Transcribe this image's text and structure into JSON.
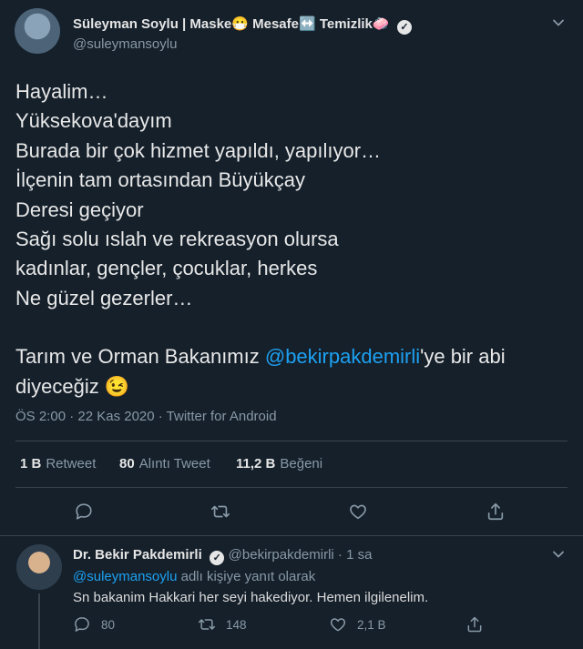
{
  "tweet": {
    "author_name": "Süleyman Soylu | Maske😷 Mesafe↔️ Temizlik🧼",
    "author_handle": "@suleymansoylu",
    "text_lines": [
      "Hayalim…",
      "Yüksekova'dayım",
      "Burada bir çok hizmet yapıldı, yapılıyor…",
      "İlçenin tam ortasından Büyükçay",
      "Deresi geçiyor",
      "Sağı solu ıslah ve rekreasyon olursa",
      "kadınlar, gençler, çocuklar, herkes",
      "Ne güzel gezerler…"
    ],
    "mention_prefix": "Tarım ve Orman Bakanımız ",
    "mention": "@bekirpakdemirli",
    "mention_suffix": "'ye bir abi",
    "last_line": "diyeceğiz 😉",
    "timestamp": "ÖS 2:00 · 22 Kas 2020 · Twitter for Android",
    "retweets_count": "1 B",
    "retweets_label": "Retweet",
    "quotes_count": "80",
    "quotes_label": "Alıntı Tweet",
    "likes_count": "11,2 B",
    "likes_label": "Beğeni"
  },
  "reply": {
    "author_name": "Dr. Bekir Pakdemirli",
    "author_handle": "@bekirpakdemirli",
    "time": " · 1 sa",
    "replying_handle": "@suleymansoylu",
    "replying_suffix": " adlı kişiye yanıt olarak",
    "text": "Sn bakanim Hakkari her seyi hakediyor. Hemen ilgilenelim.",
    "reply_count": "80",
    "retweet_count": "148",
    "like_count": "2,1 B"
  },
  "icons": {
    "reply": "reply-icon",
    "retweet": "retweet-icon",
    "like": "heart-icon",
    "share": "share-icon",
    "more": "chevron-down-icon",
    "verified": "verified-badge-icon"
  },
  "colors": {
    "background": "#15202b",
    "accent": "#1da1f2",
    "secondary_text": "#8899a6",
    "divider": "#38444d"
  }
}
